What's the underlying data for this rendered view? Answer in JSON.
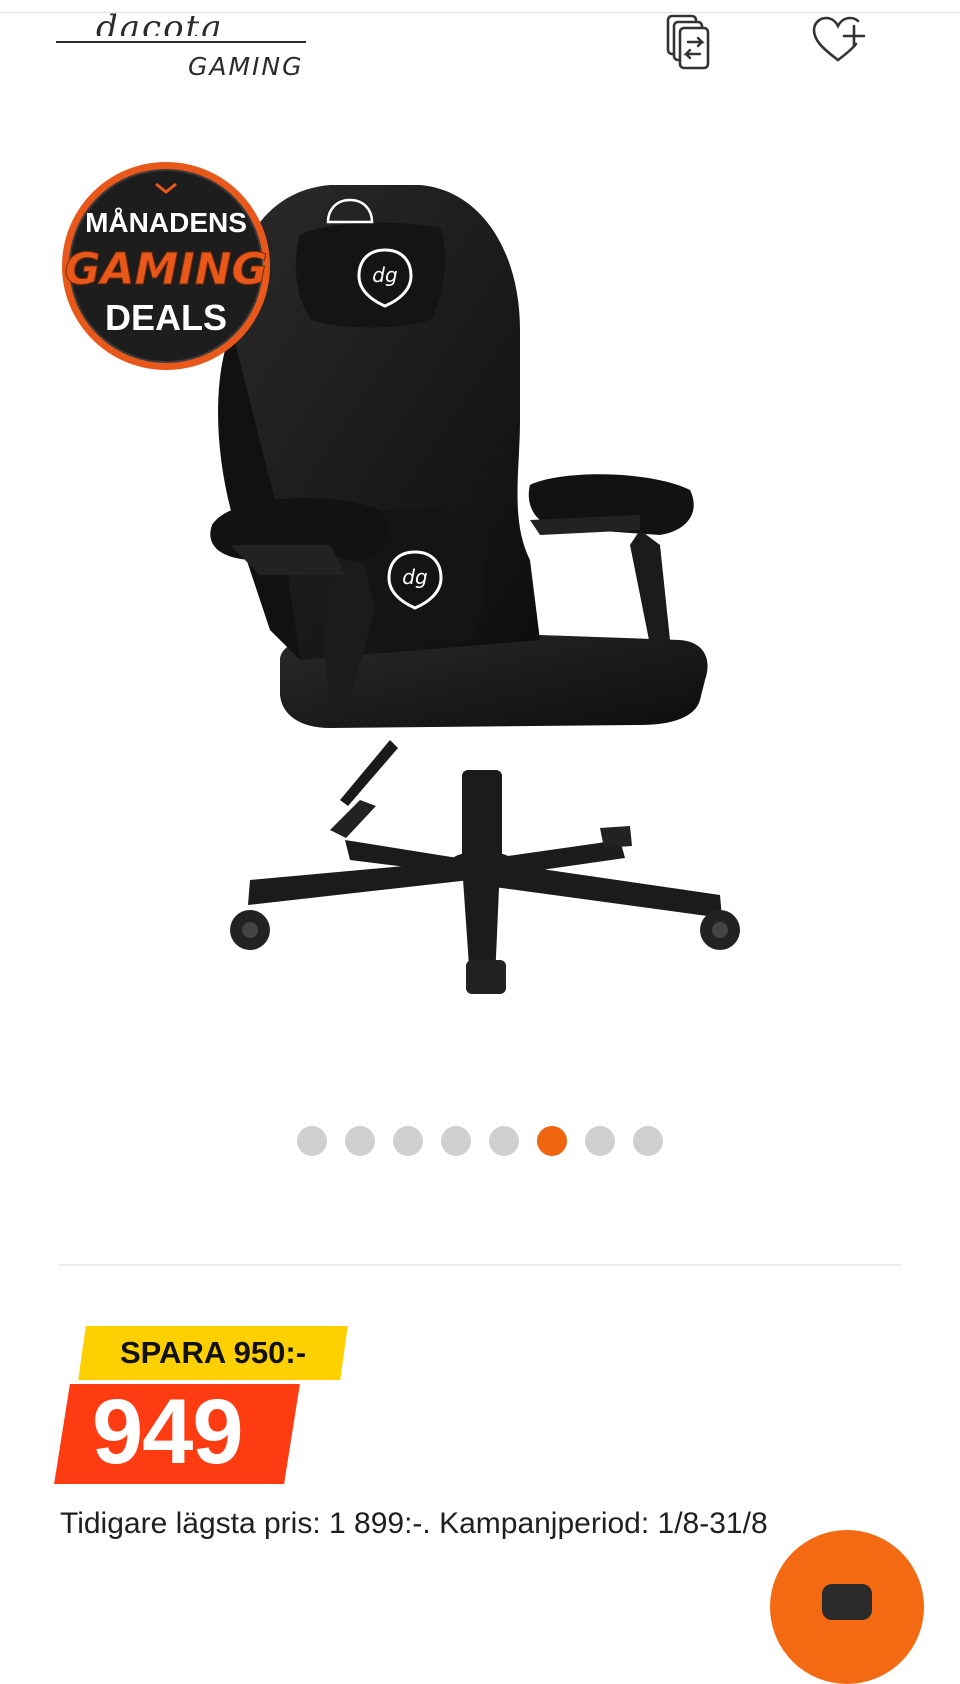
{
  "header": {
    "logo_script": "dacota",
    "logo_sub": "GAMING",
    "compare_icon": "compare-icon",
    "wishlist_icon": "heart-plus-icon"
  },
  "badge": {
    "line1": "MÅNADENS",
    "line2": "GAMING",
    "line3": "DEALS"
  },
  "gallery": {
    "image_subject": "black gaming chair",
    "emblem_text": "dg",
    "dots_count": 8,
    "active_index": 5
  },
  "price": {
    "save_label": "SPARA 950:-",
    "current": "949",
    "prior_text": "Tidigare lägsta pris: 1 899:-. Kampanjperiod: 1/8-31/8"
  },
  "colors": {
    "accent": "#f0650f",
    "price_bg": "#ff3b12",
    "save_bg": "#ffd000",
    "dot_inactive": "#cfcfcf"
  }
}
